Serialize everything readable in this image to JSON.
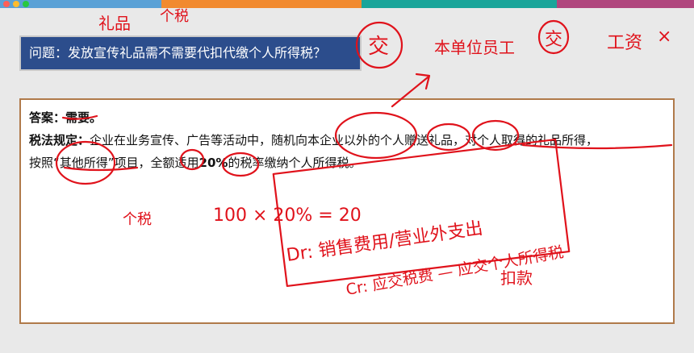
{
  "window": {
    "accent_colors": [
      "#5aa1d6",
      "#f18a2f",
      "#1aa59a",
      "#b0467e"
    ]
  },
  "question": {
    "label": "问题：",
    "text": "发放宣传礼品需不需要代扣代缴个人所得税？"
  },
  "answer": {
    "label": "答案：",
    "value": "需要。",
    "rule_label": "税法规定：",
    "rule_text_1": "企业在业务宣传、广告等活动中，随机向本企业以外的个人赠送礼品，对个人取得的礼品所得，",
    "rule_text_2a": "按照“其他所得”项目，全额适用",
    "rule_rate": "20%",
    "rule_text_2b": "的税率缴纳个人所得税。"
  },
  "annotations": {
    "top_note_1": "礼品",
    "top_note_2": "个税",
    "circled_char_1": "交",
    "right_note": "本单位员工",
    "circled_char_2": "交",
    "right_note_2": "工资",
    "right_note_3": "×",
    "calc_left": "个税",
    "calc": "100 × 20% = 20",
    "box_text": "Dr: 销售费用/营业外支出",
    "below_box": "Cr: 应交税费 — 应交个人所得税",
    "bottom_note": "扣款"
  }
}
